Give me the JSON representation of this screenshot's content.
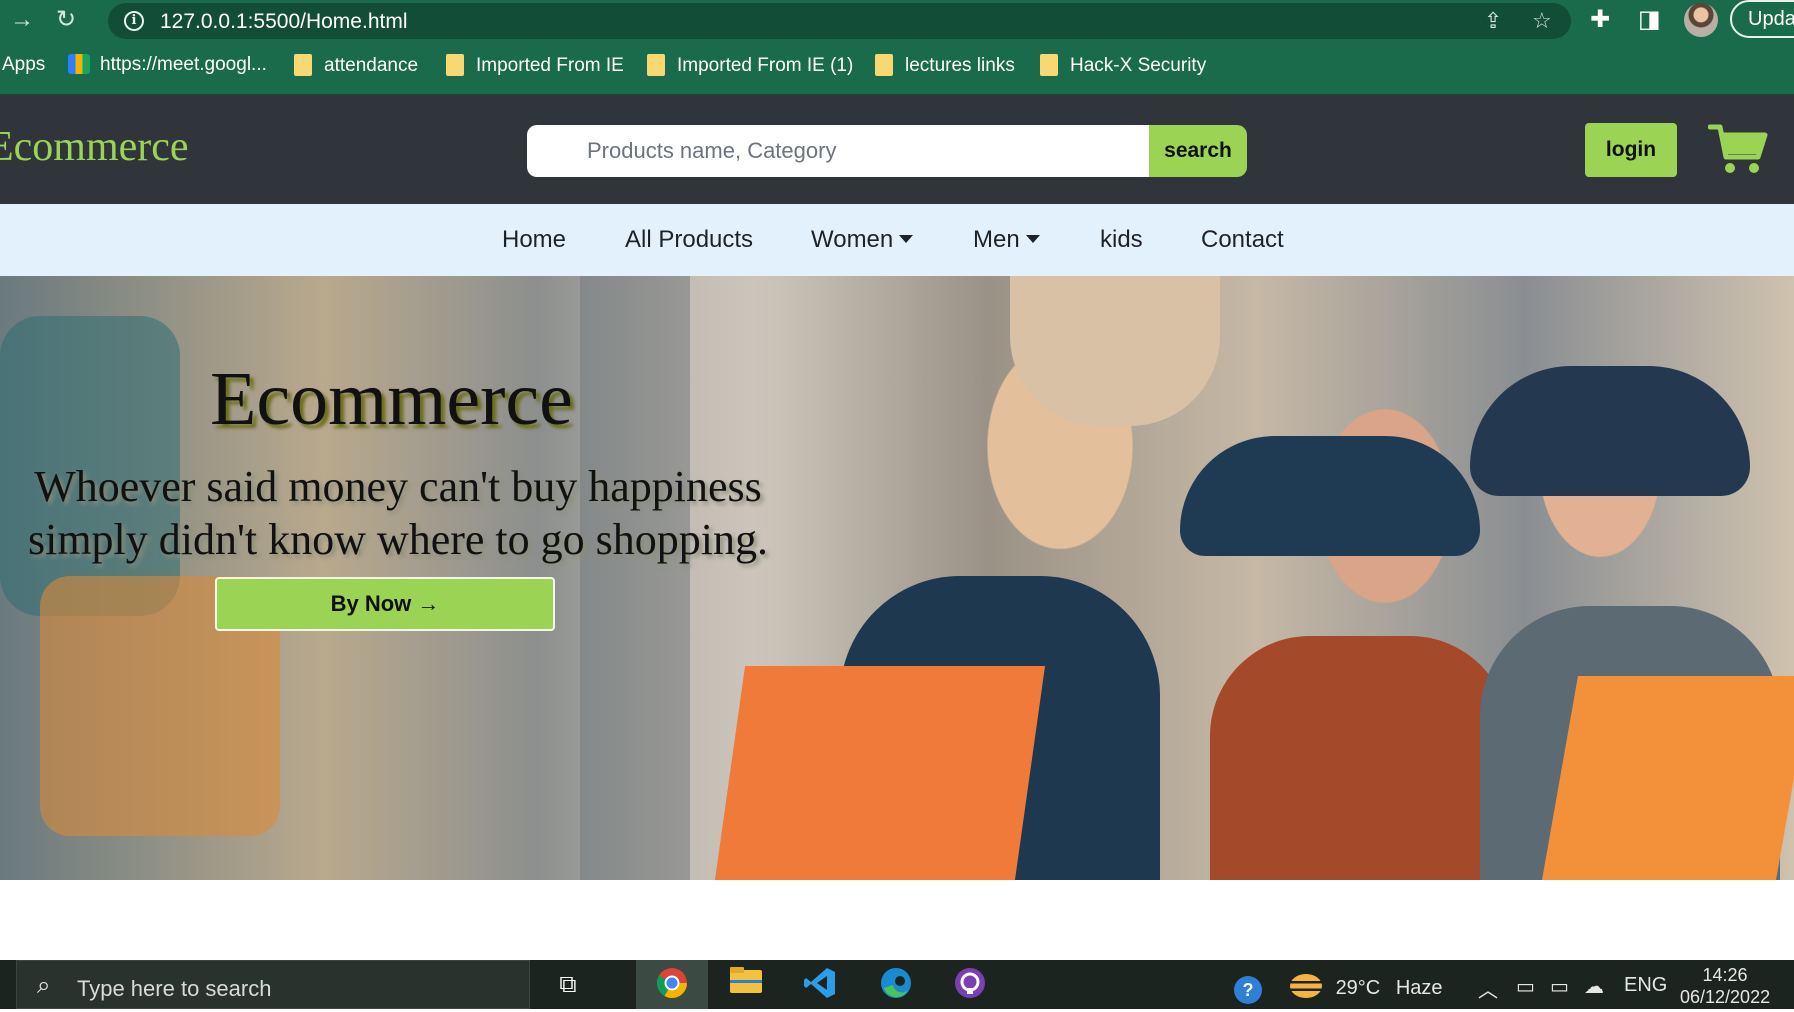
{
  "browser": {
    "url": "127.0.0.1:5500/Home.html",
    "update_label": "Upda",
    "bookmarks": [
      {
        "label": "Apps",
        "icon": "apps-grid-icon"
      },
      {
        "label": "https://meet.googl...",
        "icon": "meet-icon"
      },
      {
        "label": "attendance",
        "icon": "folder-icon"
      },
      {
        "label": "Imported From IE",
        "icon": "folder-icon"
      },
      {
        "label": "Imported From IE (1)",
        "icon": "folder-icon"
      },
      {
        "label": "lectures links",
        "icon": "folder-icon"
      },
      {
        "label": "Hack-X Security",
        "icon": "folder-icon"
      }
    ]
  },
  "header": {
    "brand": "Ecommerce",
    "search_placeholder": "Products name, Category",
    "search_label": "search",
    "login_label": "login",
    "cart_icon": "shopping-cart-icon"
  },
  "nav": {
    "items": [
      {
        "label": "Home"
      },
      {
        "label": "All Products"
      },
      {
        "label": "Women",
        "dropdown": true
      },
      {
        "label": "Men",
        "dropdown": true
      },
      {
        "label": "kids"
      },
      {
        "label": "Contact"
      }
    ]
  },
  "hero": {
    "title": "Ecommerce",
    "quote_line1": "Whoever said money can't buy happiness",
    "quote_line2": "simply didn't know where to go shopping.",
    "cta_label": "By Now →"
  },
  "taskbar": {
    "search_placeholder": "Type here to search",
    "weather_temp": "29°C",
    "weather_desc": "Haze",
    "language": "ENG",
    "time": "14:26",
    "date": "06/12/2022"
  },
  "colors": {
    "chrome": "#1a6b4c",
    "header_bg": "#2f353b",
    "accent": "#9bd454",
    "nav_bg": "#e3f1fc"
  }
}
